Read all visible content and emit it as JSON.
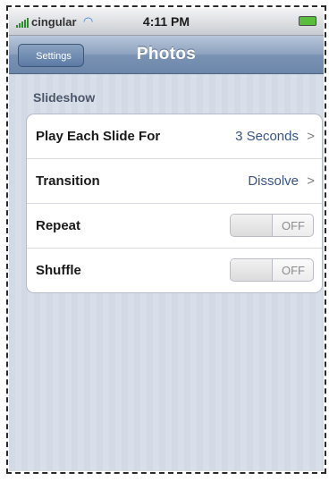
{
  "status_bar": {
    "carrier": "cingular",
    "time": "4:11 PM",
    "signal_icon": "signal-bars-icon",
    "wifi_icon": "wifi-icon",
    "battery_icon": "battery-icon"
  },
  "nav": {
    "back_label": "Settings",
    "title": "Photos"
  },
  "section": {
    "header": "Slideshow",
    "rows": [
      {
        "label": "Play Each Slide For",
        "value": "3 Seconds",
        "chevron": ">"
      },
      {
        "label": "Transition",
        "value": "Dissolve",
        "chevron": ">"
      },
      {
        "label": "Repeat",
        "toggle": "OFF"
      },
      {
        "label": "Shuffle",
        "toggle": "OFF"
      }
    ]
  },
  "colors": {
    "nav_bar": "#7a93b4",
    "background": "#d6dde8",
    "value_text": "#385487"
  }
}
